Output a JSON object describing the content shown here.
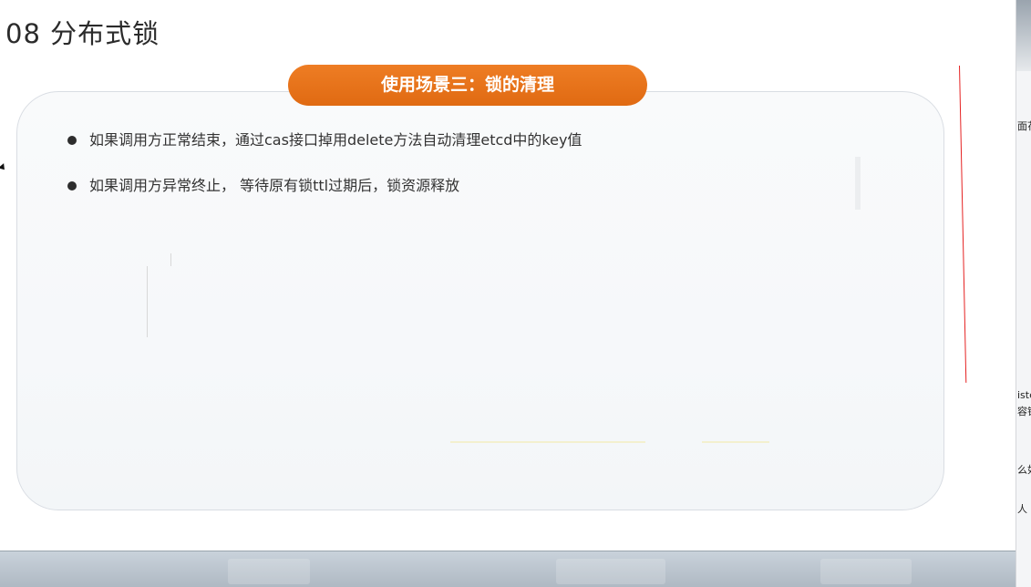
{
  "slide": {
    "title": "08 分布式锁",
    "section_label": "使用场景三：锁的清理",
    "bullets": [
      "如果调用方正常结束，通过cas接口掉用delete方法自动清理etcd中的key值",
      "如果调用方异常终止， 等待原有锁ttl过期后，锁资源释放"
    ]
  },
  "side_panel": {
    "fragments": [
      "面花",
      "iste",
      "容错",
      "么如",
      "人"
    ]
  },
  "colors": {
    "accent_orange": "#e8731a",
    "annotation_red": "#e52222",
    "title_text": "#2b2b2b",
    "body_text": "#333333"
  },
  "icons": {
    "bullet": "filled-circle",
    "cursor": "mouse-pointer"
  }
}
